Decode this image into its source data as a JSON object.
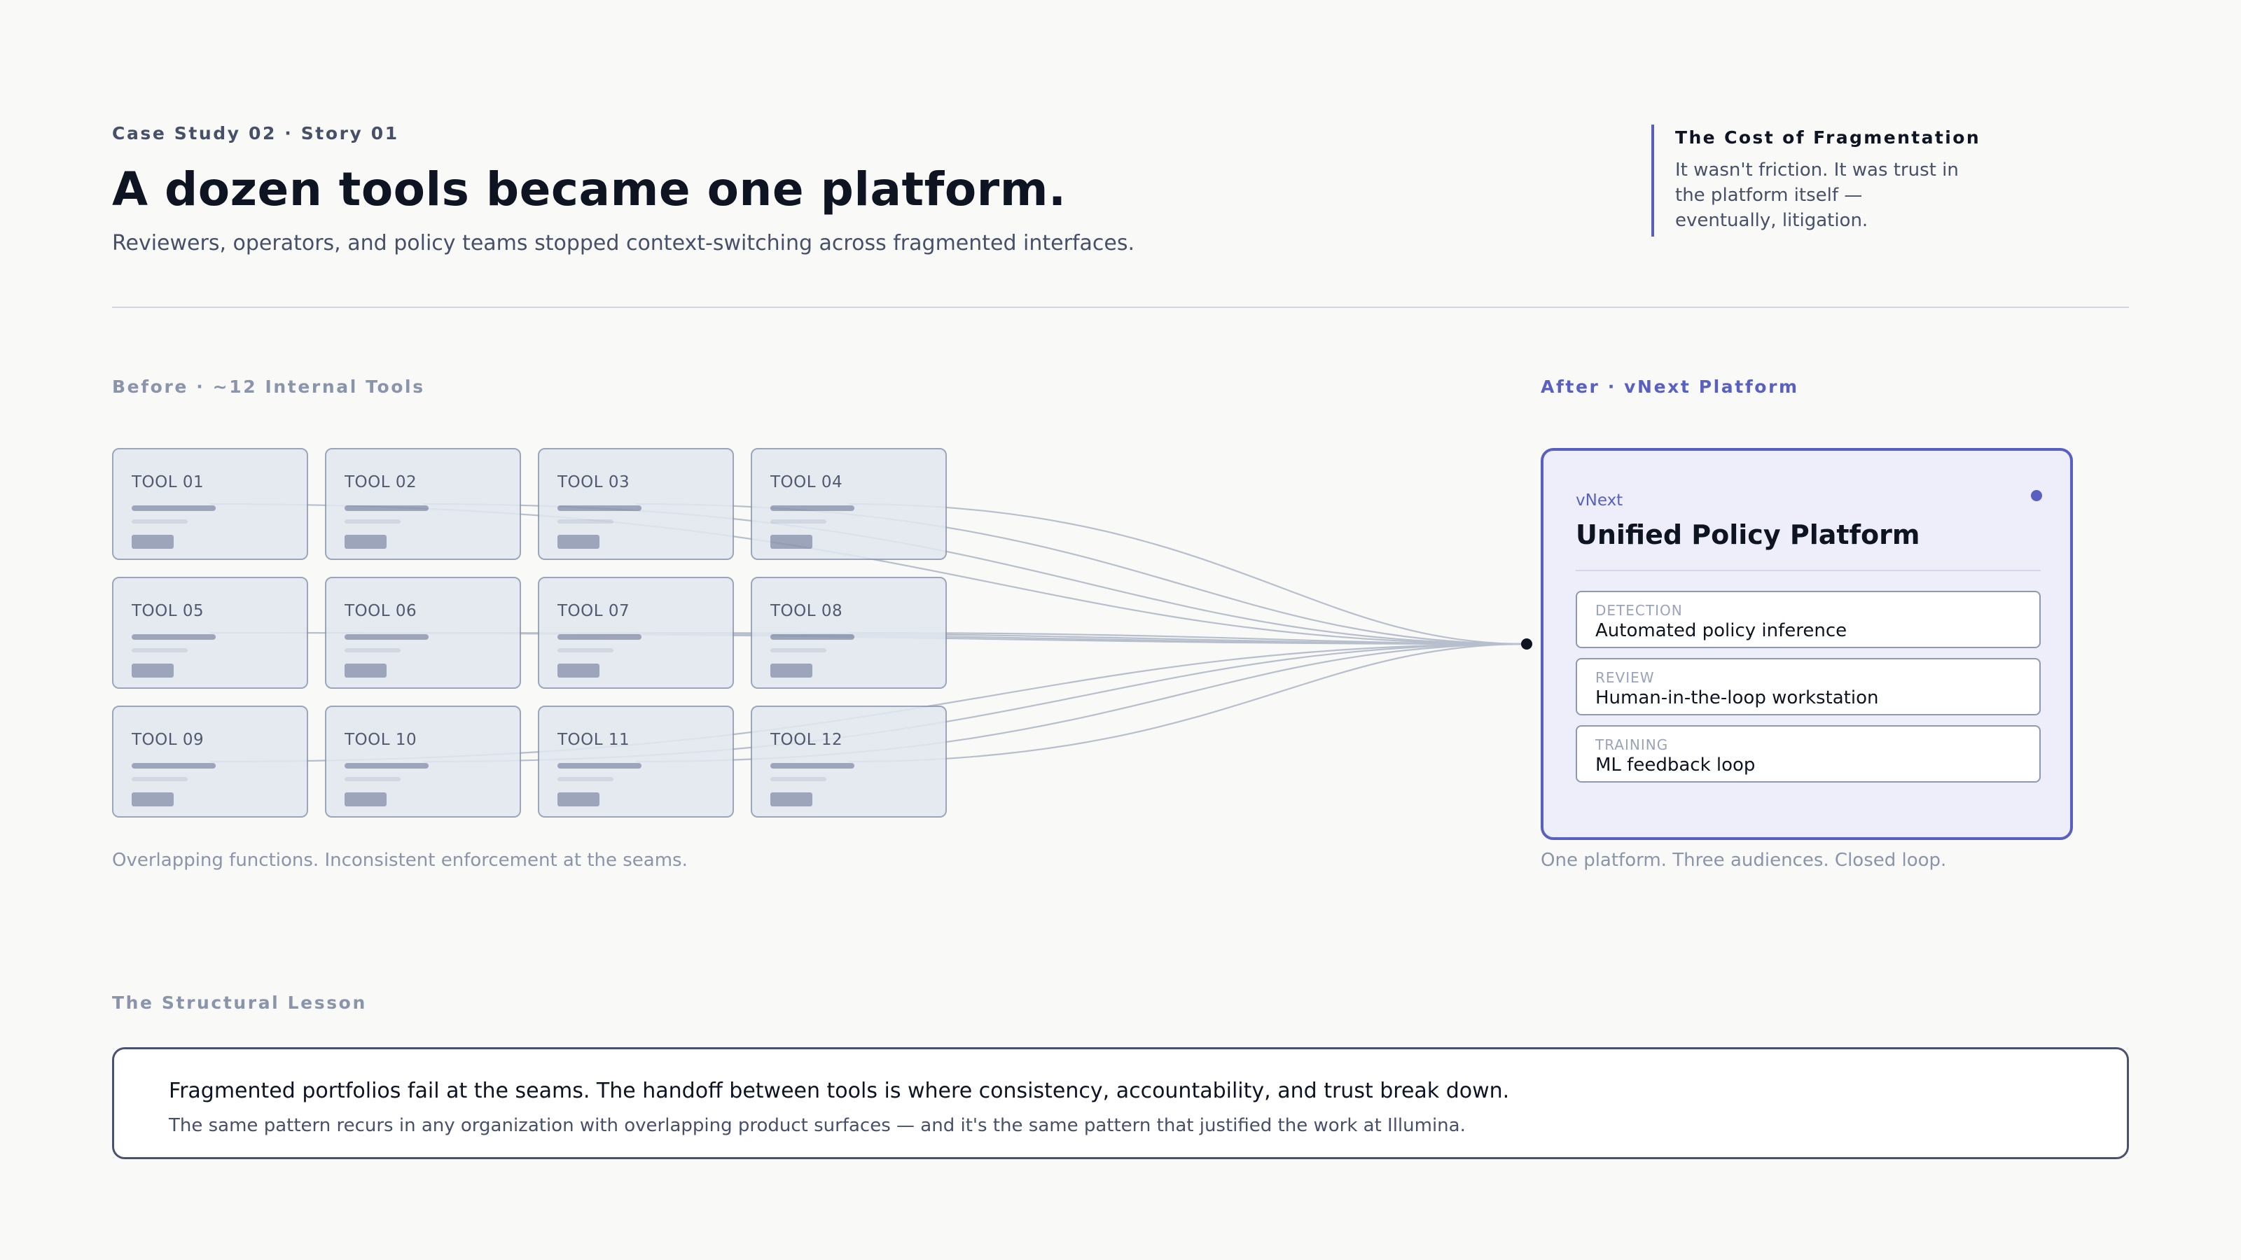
{
  "header": {
    "eyebrow": "Case Study 02 · Story 01",
    "title": "A dozen tools became one platform.",
    "subtitle": "Reviewers, operators, and policy teams stopped context-switching across fragmented interfaces."
  },
  "callout": {
    "title": "The Cost of Fragmentation",
    "body": "It wasn't friction. It was trust in the platform itself — eventually, litigation."
  },
  "before": {
    "label": "Before · ~12 Internal Tools",
    "tools": [
      "TOOL 01",
      "TOOL 02",
      "TOOL 03",
      "TOOL 04",
      "TOOL 05",
      "TOOL 06",
      "TOOL 07",
      "TOOL 08",
      "TOOL 09",
      "TOOL 10",
      "TOOL 11",
      "TOOL 12"
    ],
    "caption": "Overlapping functions. Inconsistent enforcement at the seams."
  },
  "after": {
    "label": "After · vNext Platform",
    "kicker": "vNext",
    "title": "Unified Policy Platform",
    "modules": [
      {
        "kicker": "DETECTION",
        "name": "Automated policy inference"
      },
      {
        "kicker": "REVIEW",
        "name": "Human-in-the-loop workstation"
      },
      {
        "kicker": "TRAINING",
        "name": "ML feedback loop"
      }
    ],
    "caption": "One platform. Three audiences. Closed loop."
  },
  "lesson": {
    "label": "The Structural Lesson",
    "headline": "Fragmented portfolios fail at the seams. The handoff between tools is where consistency, accountability, and trust break down.",
    "body": "The same pattern recurs in any organization with overlapping product surfaces — and it's the same pattern that justified the work at Illumina."
  },
  "colors": {
    "accent": "#5a60bf",
    "ink": "#0f1422",
    "muted": "#8a94aa",
    "tile_bg": "#e2e8f0",
    "tile_border": "#8d98b1",
    "connector": "#b7bfcd"
  }
}
